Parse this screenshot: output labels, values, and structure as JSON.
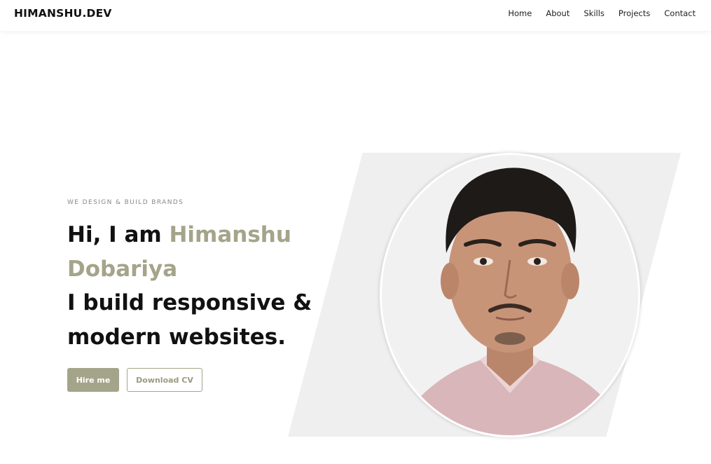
{
  "nav": {
    "brand": "HIMANSHU.DEV",
    "links": [
      "Home",
      "About",
      "Skills",
      "Projects",
      "Contact"
    ]
  },
  "hero": {
    "tagline": "WE DESIGN & BUILD BRANDS",
    "greeting": "Hi, I am ",
    "name": "Himanshu Dobariya",
    "line2": "I build responsive &",
    "line3": "modern websites."
  },
  "buttons": {
    "hire": "Hire me",
    "download": "Download CV"
  },
  "colors": {
    "accent": "#a4a48a",
    "text": "#111111",
    "shape": "#efefef"
  },
  "icons": {
    "portrait": "profile-photo"
  }
}
